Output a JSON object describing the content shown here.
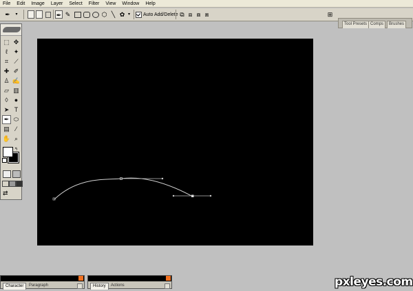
{
  "menu": [
    "File",
    "Edit",
    "Image",
    "Layer",
    "Select",
    "Filter",
    "View",
    "Window",
    "Help"
  ],
  "options_bar": {
    "auto_add_delete_label": "Auto Add/Delete"
  },
  "palette_well": {
    "tabs": [
      "Tool Presets",
      "Comps",
      "Brushes"
    ]
  },
  "bottom_panels": [
    {
      "tabs": [
        "Character",
        "Paragraph"
      ]
    },
    {
      "tabs": [
        "History",
        "Actions"
      ]
    }
  ],
  "watermark": "pxleyes.com",
  "colors": {
    "canvas": "#000000",
    "workspace": "#c0c0c0",
    "path_stroke": "#cfcfcf",
    "close_button": "#f07020"
  },
  "icons": [
    "pen-icon",
    "freeform-pen-icon",
    "rectangle-shape-icon",
    "rounded-rectangle-icon",
    "ellipse-icon",
    "polygon-icon",
    "line-icon",
    "custom-shape-icon"
  ]
}
